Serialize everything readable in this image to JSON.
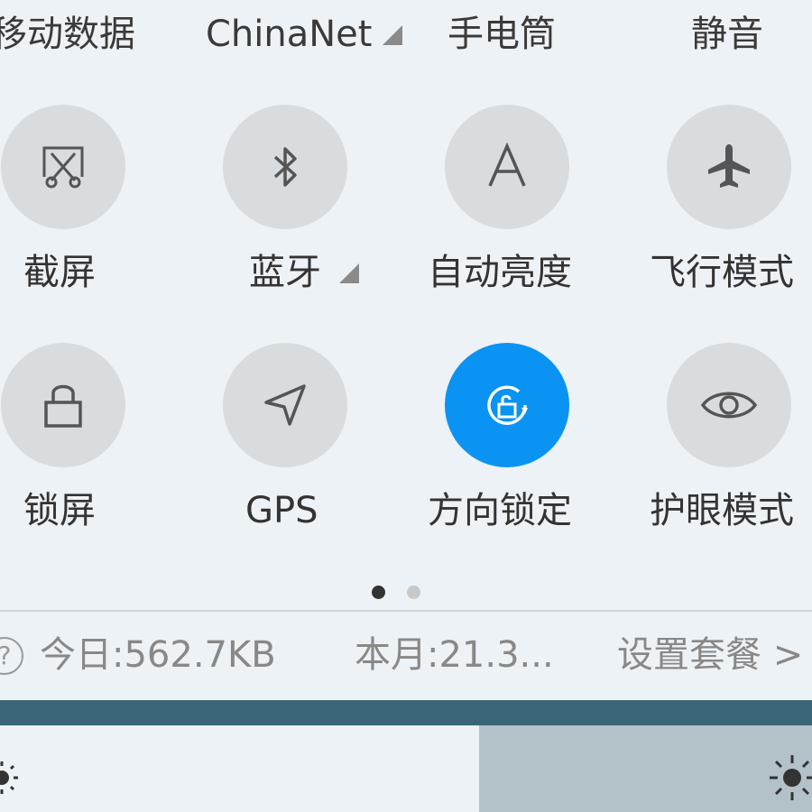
{
  "top_row": {
    "mobile_data": "移动数据",
    "carrier": "ChinaNet",
    "flashlight": "手电筒",
    "mute": "静音"
  },
  "toggles": [
    {
      "id": "screenshot",
      "label": "截屏",
      "icon": "screenshot-icon",
      "active": false
    },
    {
      "id": "bluetooth",
      "label": "蓝牙",
      "icon": "bluetooth-icon",
      "active": false,
      "has_menu": true
    },
    {
      "id": "auto_brightness",
      "label": "自动亮度",
      "icon": "auto-brightness-icon",
      "active": false
    },
    {
      "id": "airplane",
      "label": "飞行模式",
      "icon": "airplane-icon",
      "active": false
    },
    {
      "id": "lock_screen",
      "label": "锁屏",
      "icon": "lock-icon",
      "active": false
    },
    {
      "id": "gps",
      "label": "GPS",
      "icon": "gps-icon",
      "active": false
    },
    {
      "id": "rotation_lock",
      "label": "方向锁定",
      "icon": "rotation-lock-icon",
      "active": true
    },
    {
      "id": "eye_comfort",
      "label": "护眼模式",
      "icon": "eye-icon",
      "active": false
    }
  ],
  "pager": {
    "pages": 2,
    "current": 1
  },
  "usage": {
    "today": "今日:562.7KB",
    "month": "本月:21.3...",
    "settings": "设置套餐 >"
  },
  "brightness": {
    "level": 0.59
  },
  "colors": {
    "background": "#edf2f6",
    "toggle_off": "#d8dcdf",
    "toggle_on": "#0a93f2",
    "band": "#3a6577",
    "slider_fill": "#b3c2c9"
  }
}
